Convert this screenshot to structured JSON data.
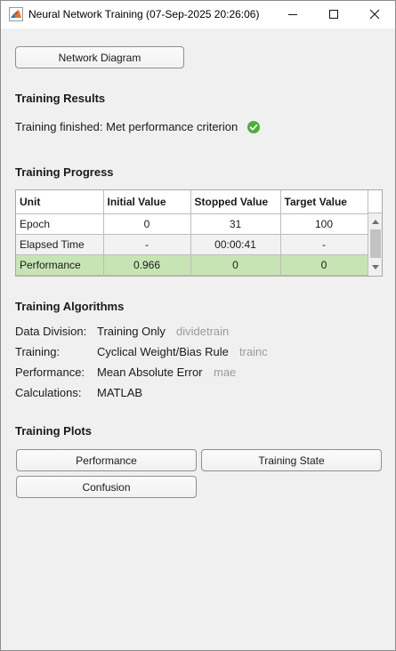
{
  "window": {
    "title": "Neural Network Training (07-Sep-2025 20:26:06)",
    "controls": {
      "minimize": "minimize-icon",
      "maximize": "maximize-icon",
      "close": "close-icon"
    },
    "app_icon": "matlab-icon"
  },
  "buttons": {
    "network_diagram": "Network Diagram"
  },
  "results": {
    "heading": "Training Results",
    "status_text": "Training finished: Met performance criterion",
    "status_icon": "check-circle-icon",
    "status_color": "#4caf38"
  },
  "progress": {
    "heading": "Training Progress",
    "columns": [
      "Unit",
      "Initial Value",
      "Stopped Value",
      "Target Value"
    ],
    "rows": [
      {
        "unit": "Epoch",
        "initial": "0",
        "stopped": "31",
        "target": "100"
      },
      {
        "unit": "Elapsed Time",
        "initial": "-",
        "stopped": "00:00:41",
        "target": "-"
      },
      {
        "unit": "Performance",
        "initial": "0.966",
        "stopped": "0",
        "target": "0"
      }
    ],
    "selected_color": "#c7e5b4"
  },
  "algorithms": {
    "heading": "Training Algorithms",
    "items": [
      {
        "label": "Data Division:",
        "value": "Training Only",
        "code": "dividetrain"
      },
      {
        "label": "Training:",
        "value": "Cyclical Weight/Bias Rule",
        "code": "trainc"
      },
      {
        "label": "Performance:",
        "value": "Mean Absolute Error",
        "code": "mae"
      },
      {
        "label": "Calculations:",
        "value": "MATLAB",
        "code": ""
      }
    ]
  },
  "plots": {
    "heading": "Training Plots",
    "buttons": [
      "Performance",
      "Training State",
      "Confusion"
    ]
  }
}
